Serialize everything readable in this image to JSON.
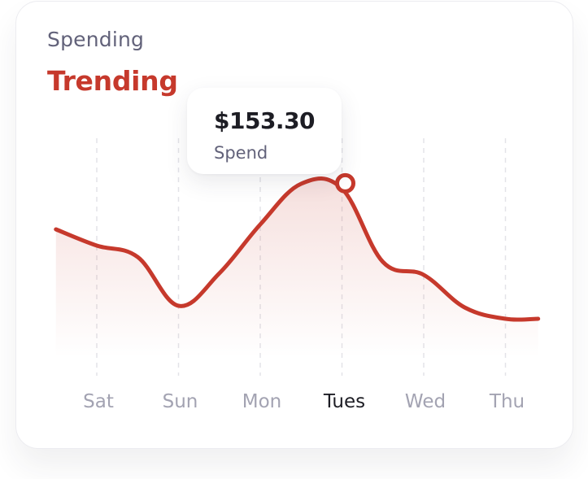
{
  "header": {
    "subtitle": "Spending",
    "title": "Trending"
  },
  "tooltip": {
    "value": "$153.30",
    "label": "Spend"
  },
  "colors": {
    "accent": "#c6392c",
    "muted_text": "#a3a3b2",
    "active_text": "#1d1d24",
    "gridline": "#e3e3e8"
  },
  "chart_data": {
    "type": "area",
    "categories": [
      "Sat",
      "Sun",
      "Mon",
      "Tues",
      "Wed",
      "Thu"
    ],
    "highlighted_category": "Tues",
    "highlighted_value": 153.3,
    "series": [
      {
        "x": [
          -0.5,
          0,
          0.5,
          1,
          1.5,
          2,
          2.5,
          3,
          3.5,
          4,
          4.5,
          5,
          5.4
        ],
        "values": [
          125,
          115,
          108,
          78,
          98,
          128,
          153,
          150,
          105,
          97,
          77,
          70,
          70
        ]
      }
    ],
    "grid": "vertical dashed",
    "legend": "none"
  }
}
